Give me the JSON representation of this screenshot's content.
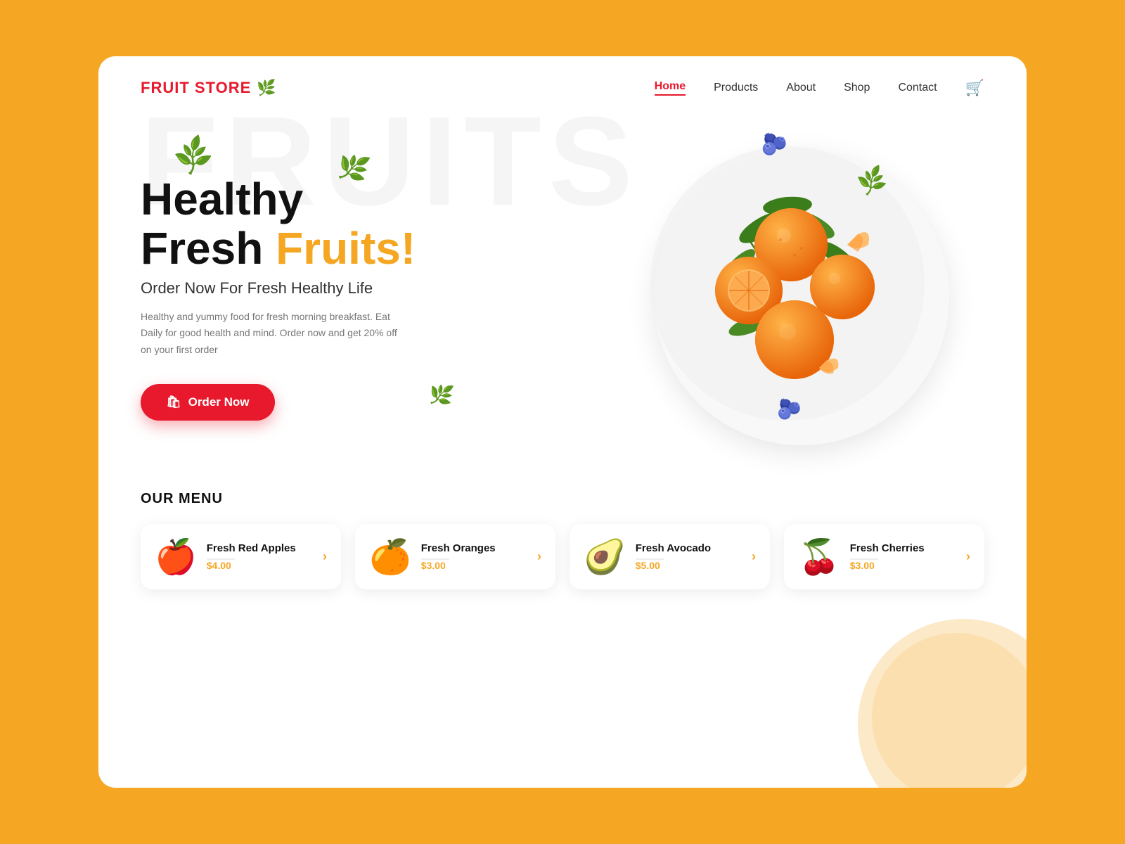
{
  "brand": {
    "name_fruit": "FRUIT",
    "name_store": " STORE",
    "icon": "🌿"
  },
  "nav": {
    "items": [
      {
        "label": "Home",
        "active": true
      },
      {
        "label": "Products",
        "active": false
      },
      {
        "label": "About",
        "active": false
      },
      {
        "label": "Shop",
        "active": false
      },
      {
        "label": "Contact",
        "active": false
      }
    ]
  },
  "hero": {
    "title_line1": "Healthy",
    "title_line2_black": "Fresh ",
    "title_line2_orange": "Fruits!",
    "subtitle": "Order Now For Fresh Healthy Life",
    "description": "Healthy and yummy food for fresh morning breakfast. Eat Daily for good health and mind. Order now and get 20% off on your first order",
    "cta_label": "Order Now"
  },
  "menu": {
    "section_title": "OUR MENU",
    "items": [
      {
        "name": "Fresh Red Apples",
        "price": "$4.00",
        "icon": "🍎"
      },
      {
        "name": "Fresh Oranges",
        "price": "$3.00",
        "icon": "🍊"
      },
      {
        "name": "Fresh Avocado",
        "price": "$5.00",
        "icon": "🥑"
      },
      {
        "name": "Fresh Cherries",
        "price": "$3.00",
        "icon": "🍒"
      }
    ]
  },
  "bg_text": "FRUITS",
  "colors": {
    "brand_red": "#E8192C",
    "brand_orange": "#F5A623",
    "bg": "#F5A623",
    "white": "#ffffff"
  }
}
